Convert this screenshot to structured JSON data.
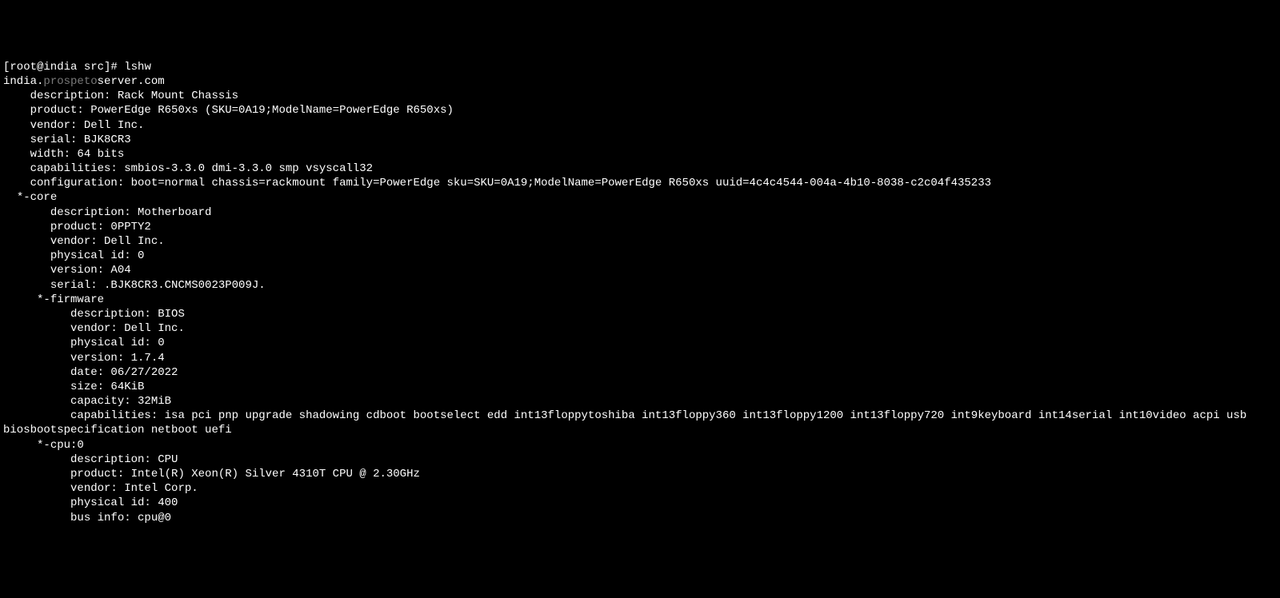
{
  "terminal": {
    "prompt_user": "[root@india src]#",
    "command": "lshw",
    "hostname_pre": "india.",
    "hostname_dim": "prospeto",
    "hostname_post": "server.com",
    "system": {
      "description": "    description: Rack Mount Chassis",
      "product": "    product: PowerEdge R650xs (SKU=0A19;ModelName=PowerEdge R650xs)",
      "vendor": "    vendor: Dell Inc.",
      "serial": "    serial: BJK8CR3",
      "width": "    width: 64 bits",
      "capabilities": "    capabilities: smbios-3.3.0 dmi-3.3.0 smp vsyscall32",
      "configuration": "    configuration: boot=normal chassis=rackmount family=PowerEdge sku=SKU=0A19;ModelName=PowerEdge R650xs uuid=4c4c4544-004a-4b10-8038-c2c04f435233"
    },
    "core": {
      "header": "  *-core",
      "description": "       description: Motherboard",
      "product": "       product: 0PPTY2",
      "vendor": "       vendor: Dell Inc.",
      "physical_id": "       physical id: 0",
      "version": "       version: A04",
      "serial": "       serial: .BJK8CR3.CNCMS0023P009J."
    },
    "firmware": {
      "header": "     *-firmware",
      "description": "          description: BIOS",
      "vendor": "          vendor: Dell Inc.",
      "physical_id": "          physical id: 0",
      "version": "          version: 1.7.4",
      "date": "          date: 06/27/2022",
      "size": "          size: 64KiB",
      "capacity": "          capacity: 32MiB",
      "capabilities": "          capabilities: isa pci pnp upgrade shadowing cdboot bootselect edd int13floppytoshiba int13floppy360 int13floppy1200 int13floppy720 int9keyboard int14serial int10video acpi usb biosbootspecification netboot uefi"
    },
    "cpu": {
      "header": "     *-cpu:0",
      "description": "          description: CPU",
      "product": "          product: Intel(R) Xeon(R) Silver 4310T CPU @ 2.30GHz",
      "vendor": "          vendor: Intel Corp.",
      "physical_id": "          physical id: 400",
      "bus_info": "          bus info: cpu@0"
    }
  }
}
